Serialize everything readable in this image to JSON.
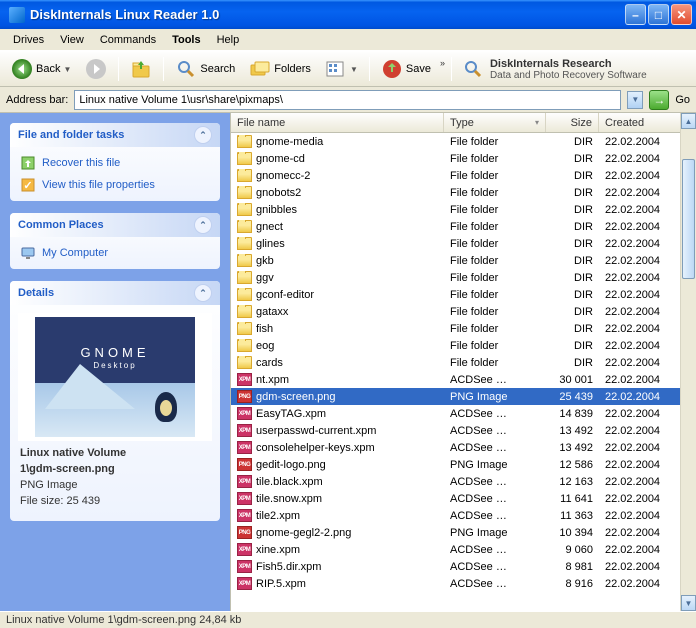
{
  "window": {
    "title": "DiskInternals Linux Reader 1.0"
  },
  "menu": [
    "Drives",
    "View",
    "Commands",
    "Tools",
    "Help"
  ],
  "toolbar": {
    "back": "Back",
    "search": "Search",
    "folders": "Folders",
    "save": "Save"
  },
  "research": {
    "line1": "DiskInternals Research",
    "line2": "Data and Photo Recovery Software"
  },
  "address": {
    "label": "Address bar:",
    "path": "Linux native Volume 1\\usr\\share\\pixmaps\\",
    "go": "Go"
  },
  "sidebar": {
    "tasks": {
      "title": "File and folder tasks",
      "items": [
        "Recover this file",
        "View this file properties"
      ]
    },
    "places": {
      "title": "Common Places",
      "items": [
        "My Computer"
      ]
    },
    "details": {
      "title": "Details",
      "name_line1": "Linux native Volume",
      "name_line2": "1\\gdm-screen.png",
      "type": "PNG Image",
      "size": "File size: 25 439"
    }
  },
  "columns": {
    "name": "File name",
    "type": "Type",
    "size": "Size",
    "created": "Created"
  },
  "files": [
    {
      "n": "gnome-media",
      "t": "File folder",
      "s": "DIR",
      "c": "22.02.2004",
      "i": "folder"
    },
    {
      "n": "gnome-cd",
      "t": "File folder",
      "s": "DIR",
      "c": "22.02.2004",
      "i": "folder"
    },
    {
      "n": "gnomecc-2",
      "t": "File folder",
      "s": "DIR",
      "c": "22.02.2004",
      "i": "folder"
    },
    {
      "n": "gnobots2",
      "t": "File folder",
      "s": "DIR",
      "c": "22.02.2004",
      "i": "folder"
    },
    {
      "n": "gnibbles",
      "t": "File folder",
      "s": "DIR",
      "c": "22.02.2004",
      "i": "folder"
    },
    {
      "n": "gnect",
      "t": "File folder",
      "s": "DIR",
      "c": "22.02.2004",
      "i": "folder"
    },
    {
      "n": "glines",
      "t": "File folder",
      "s": "DIR",
      "c": "22.02.2004",
      "i": "folder"
    },
    {
      "n": "gkb",
      "t": "File folder",
      "s": "DIR",
      "c": "22.02.2004",
      "i": "folder"
    },
    {
      "n": "ggv",
      "t": "File folder",
      "s": "DIR",
      "c": "22.02.2004",
      "i": "folder"
    },
    {
      "n": "gconf-editor",
      "t": "File folder",
      "s": "DIR",
      "c": "22.02.2004",
      "i": "folder"
    },
    {
      "n": "gataxx",
      "t": "File folder",
      "s": "DIR",
      "c": "22.02.2004",
      "i": "folder"
    },
    {
      "n": "fish",
      "t": "File folder",
      "s": "DIR",
      "c": "22.02.2004",
      "i": "folder"
    },
    {
      "n": "eog",
      "t": "File folder",
      "s": "DIR",
      "c": "22.02.2004",
      "i": "folder"
    },
    {
      "n": "cards",
      "t": "File folder",
      "s": "DIR",
      "c": "22.02.2004",
      "i": "folder"
    },
    {
      "n": "nt.xpm",
      "t": "ACDSee …",
      "s": "30 001",
      "c": "22.02.2004",
      "i": "xpm"
    },
    {
      "n": "gdm-screen.png",
      "t": "PNG Image",
      "s": "25 439",
      "c": "22.02.2004",
      "i": "png",
      "sel": true
    },
    {
      "n": "EasyTAG.xpm",
      "t": "ACDSee …",
      "s": "14 839",
      "c": "22.02.2004",
      "i": "xpm"
    },
    {
      "n": "userpasswd-current.xpm",
      "t": "ACDSee …",
      "s": "13 492",
      "c": "22.02.2004",
      "i": "xpm"
    },
    {
      "n": "consolehelper-keys.xpm",
      "t": "ACDSee …",
      "s": "13 492",
      "c": "22.02.2004",
      "i": "xpm"
    },
    {
      "n": "gedit-logo.png",
      "t": "PNG Image",
      "s": "12 586",
      "c": "22.02.2004",
      "i": "png"
    },
    {
      "n": "tile.black.xpm",
      "t": "ACDSee …",
      "s": "12 163",
      "c": "22.02.2004",
      "i": "xpm"
    },
    {
      "n": "tile.snow.xpm",
      "t": "ACDSee …",
      "s": "11 641",
      "c": "22.02.2004",
      "i": "xpm"
    },
    {
      "n": "tile2.xpm",
      "t": "ACDSee …",
      "s": "11 363",
      "c": "22.02.2004",
      "i": "xpm"
    },
    {
      "n": "gnome-gegl2-2.png",
      "t": "PNG Image",
      "s": "10 394",
      "c": "22.02.2004",
      "i": "png"
    },
    {
      "n": "xine.xpm",
      "t": "ACDSee …",
      "s": "9 060",
      "c": "22.02.2004",
      "i": "xpm"
    },
    {
      "n": "Fish5.dir.xpm",
      "t": "ACDSee …",
      "s": "8 981",
      "c": "22.02.2004",
      "i": "xpm"
    },
    {
      "n": "RIP.5.xpm",
      "t": "ACDSee …",
      "s": "8 916",
      "c": "22.02.2004",
      "i": "xpm"
    }
  ],
  "statusbar": "Linux native Volume 1\\gdm-screen.png 24,84 kb"
}
